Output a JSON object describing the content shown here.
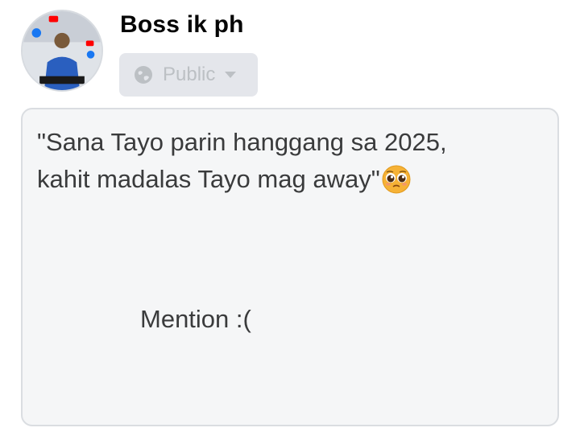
{
  "post_header": {
    "author_name": "Boss ik ph",
    "privacy_label": "Public",
    "avatar_icon": "profile-photo-icon"
  },
  "composer": {
    "text_line1": "\"Sana Tayo parin hanggang sa 2025,",
    "text_line2": "kahit madalas Tayo mag away\"",
    "emoji": "pleading-face-icon",
    "mention_text": "Mention :("
  },
  "colors": {
    "name": "#050505",
    "privacy_bg": "#e4e6eb",
    "privacy_fg": "#bcc0c4",
    "box_bg": "#f5f6f7",
    "box_border": "#dadde1",
    "text": "#3a3b3c"
  }
}
